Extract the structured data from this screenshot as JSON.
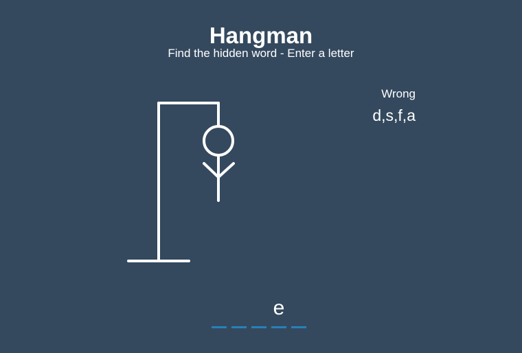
{
  "header": {
    "title": "Hangman",
    "subtitle": "Find the hidden word - Enter a letter"
  },
  "hangman": {
    "parts_shown": [
      "head",
      "body",
      "left-arm",
      "right-arm"
    ],
    "wrong_guess_count": 4
  },
  "wrong": {
    "label": "Wrong",
    "letters": "d,s,f,a"
  },
  "word": {
    "letters": [
      "",
      "",
      "",
      "e",
      ""
    ]
  },
  "colors": {
    "background": "#34495e",
    "figure": "#ffffff",
    "blank_underline": "#2980b9"
  }
}
